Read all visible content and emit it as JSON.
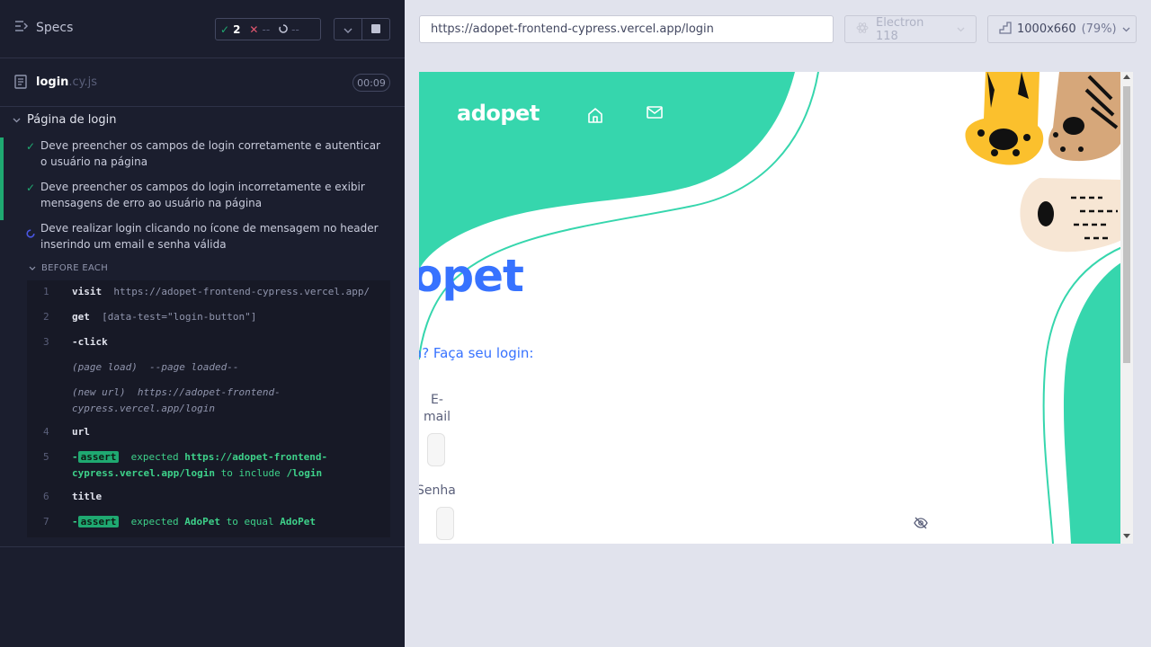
{
  "colors": {
    "reporter_bg": "#1b1e2e",
    "pass": "#1fa971",
    "fail": "#e45770",
    "brand_teal": "#36d6ad",
    "brand_blue": "#3772ff"
  },
  "header": {
    "title": "Specs",
    "stats": {
      "passed": "2",
      "failed": "--",
      "pending": "--"
    }
  },
  "spec_file": {
    "name": "login",
    "ext": ".cy.js",
    "duration": "00:09"
  },
  "suite": {
    "title": "Página de login",
    "tests": [
      {
        "state": "passed",
        "title": "Deve preencher os campos de login corretamente e autenticar o usuário na página"
      },
      {
        "state": "passed",
        "title": "Deve preencher os campos do login incorretamente e exibir mensagens de erro ao usuário na página"
      },
      {
        "state": "running",
        "title": "Deve realizar login clicando no ícone de mensagem no header inserindo um email e senha válida"
      }
    ],
    "hook_title": "BEFORE EACH",
    "commands": [
      {
        "num": "1",
        "name": "visit",
        "arg": "https://adopet-frontend-cypress.vercel.app/"
      },
      {
        "num": "2",
        "name": "get",
        "arg": "[data-test=\"login-button\"]"
      },
      {
        "num": "3",
        "name": "-click"
      },
      {
        "event": "(page load)",
        "detail": "--page loaded--"
      },
      {
        "event": "(new url)",
        "detail": "https://adopet-frontend-cypress.vercel.app/login"
      },
      {
        "num": "4",
        "name": "url"
      },
      {
        "num": "5",
        "prefix": "-",
        "badge": "assert",
        "expected": "expected",
        "value": "https://adopet-frontend-cypress.vercel.app/login",
        "op": "to include",
        "target": "/login"
      },
      {
        "num": "6",
        "name": "title"
      },
      {
        "num": "7",
        "prefix": "-",
        "badge": "assert",
        "expected": "expected",
        "value": "AdoPet",
        "op": "to equal",
        "target": "AdoPet"
      }
    ]
  },
  "browser": {
    "url": "https://adopet-frontend-cypress.vercel.app/login",
    "name": "Electron 118",
    "viewport": "1000x660",
    "zoom": "(79%)"
  },
  "app": {
    "logo": "adopet",
    "big_logo_visible": "opet",
    "login_prompt_visible": "a? Faça seu login:",
    "email_label": "E-mail",
    "senha_label": "Senha",
    "icons": [
      "home-icon",
      "mail-icon",
      "eye-off-icon"
    ]
  }
}
